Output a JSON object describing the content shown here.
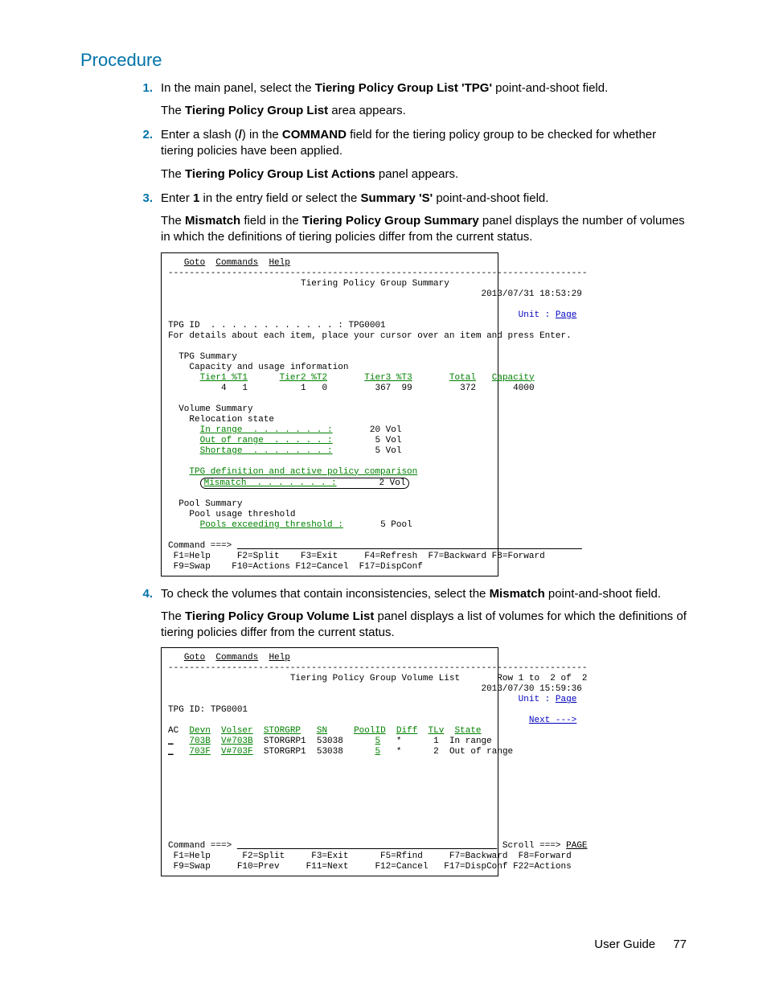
{
  "heading": "Procedure",
  "steps": {
    "s1": {
      "num": "1.",
      "p1a": "In the main panel, select the ",
      "p1b": "Tiering Policy Group List 'TPG'",
      "p1c": " point-and-shoot field.",
      "p2a": "The ",
      "p2b": "Tiering Policy Group List",
      "p2c": " area appears."
    },
    "s2": {
      "num": "2.",
      "p1a": "Enter a slash (",
      "p1b": "/",
      "p1c": ") in the ",
      "p1d": "COMMAND",
      "p1e": " field for the tiering policy group to be checked for whether tiering policies have been applied.",
      "p2a": "The ",
      "p2b": "Tiering Policy Group List Actions",
      "p2c": " panel appears."
    },
    "s3": {
      "num": "3.",
      "p1a": "Enter ",
      "p1b": "1",
      "p1c": " in the entry field or select the ",
      "p1d": "Summary 'S'",
      "p1e": " point-and-shoot field.",
      "p2a": "The ",
      "p2b": "Mismatch",
      "p2c": " field in the ",
      "p2d": "Tiering Policy Group Summary",
      "p2e": " panel displays the number of volumes in which the definitions of tiering policies differ from the current status."
    },
    "s4": {
      "num": "4.",
      "p1a": "To check the volumes that contain inconsistencies, select the ",
      "p1b": "Mismatch",
      "p1c": " point-and-shoot field.",
      "p2a": "The ",
      "p2b": "Tiering Policy Group Volume List",
      "p2c": " panel displays a list of volumes for which the definitions of tiering policies differ from the current status."
    }
  },
  "panel1": {
    "menu_goto": "Goto",
    "menu_commands": "Commands",
    "menu_help": "Help",
    "hr": "-------------------------------------------------------------------------------",
    "title": "Tiering Policy Group Summary",
    "timestamp": "2013/07/31 18:53:29",
    "unit_label": "Unit :",
    "unit_value": "Page",
    "tpg_label": "TPG ID  . . . . . . . . . . . . :",
    "tpg_value": "TPG0001",
    "hint": "For details about each item, place your cursor over an item and press Enter.",
    "tpg_summary": "TPG Summary",
    "cap_line": "Capacity and usage information",
    "hdr_t1": "Tier1 %T1",
    "hdr_t2": "Tier2 %T2",
    "hdr_t3": "Tier3 %T3",
    "hdr_total": "Total",
    "hdr_cap": "Capacity",
    "val_t1": "4   1",
    "val_t2": "1   0",
    "val_t3": "367  99",
    "val_total": "372",
    "val_cap": "4000",
    "vol_summary": "Volume Summary",
    "reloc": "Relocation state",
    "inrange_l": "In range  . . . . . . . :",
    "inrange_v": "20 Vol",
    "outrange_l": "Out of range  . . . . . :",
    "outrange_v": "5 Vol",
    "shortage_l": "Shortage  . . . . . . . :",
    "shortage_v": "5 Vol",
    "tpgdef": "TPG definition and active policy comparison",
    "mismatch_l": "Mismatch  . . . . . . . :",
    "mismatch_v": "2 Vol",
    "pool_summary": "Pool Summary",
    "pool_thresh": "Pool usage threshold",
    "pool_exceed_l": "Pools exceeding threshold :",
    "pool_exceed_v": "5 Pool",
    "cmd": "Command ===>",
    "fk1": "F1=Help     F2=Split    F3=Exit     F4=Refresh  F7=Backward F8=Forward",
    "fk2": "F9=Swap    F10=Actions F12=Cancel  F17=DispConf"
  },
  "panel2": {
    "menu_goto": "Goto",
    "menu_commands": "Commands",
    "menu_help": "Help",
    "hr": "-------------------------------------------------------------------------------",
    "title": "Tiering Policy Group Volume List",
    "row_info": "Row 1 to  2 of  2",
    "timestamp": "2013/07/30 15:59:36",
    "unit_label": "Unit :",
    "unit_value": "Page",
    "tpg_label": "TPG ID:",
    "tpg_value": "TPG0001",
    "next": "Next --->",
    "h_ac": "AC",
    "h_devn": "Devn",
    "h_volser": "Volser",
    "h_storgrp": "STORGRP",
    "h_sn": "SN",
    "h_poolid": "PoolID",
    "h_diff": "Diff",
    "h_tlv": "TLv",
    "h_state": "State",
    "r1_ac": "_",
    "r1_devn": "703B",
    "r1_volser": "V#703B",
    "r1_storgrp": "STORGRP1",
    "r1_sn": "53038",
    "r1_poolid": "5",
    "r1_diff": "*",
    "r1_tlv": "1",
    "r1_state": "In range",
    "r2_ac": "_",
    "r2_devn": "703F",
    "r2_volser": "V#703F",
    "r2_storgrp": "STORGRP1",
    "r2_sn": "53038",
    "r2_poolid": "5",
    "r2_diff": "*",
    "r2_tlv": "2",
    "r2_state": "Out of range",
    "cmd": "Command ===>",
    "scroll_l": "Scroll ===>",
    "scroll_v": "PAGE",
    "fk1": " F1=Help      F2=Split     F3=Exit      F5=Rfind     F7=Backward  F8=Forward",
    "fk2": " F9=Swap     F10=Prev     F11=Next     F12=Cancel   F17=DispConf F22=Actions"
  },
  "footer": {
    "title": "User Guide",
    "page": "77"
  }
}
